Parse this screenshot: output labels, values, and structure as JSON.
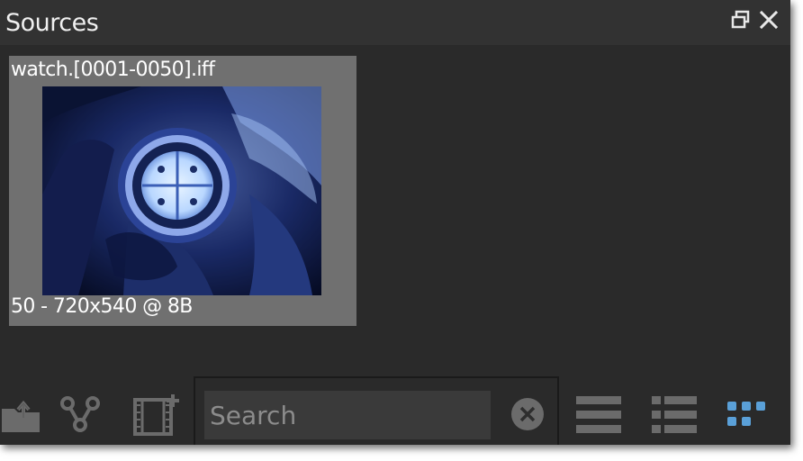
{
  "panel": {
    "title": "Sources",
    "accent_color": "#5aa0d8"
  },
  "source_item": {
    "name": "watch.[0001-0050].iff",
    "info": "50 - 720x540 @ 8B"
  },
  "toolbar": {
    "icons": [
      "import-folder-icon",
      "node-graph-icon",
      "add-clip-icon",
      "list-view-icon",
      "detail-view-icon",
      "grid-view-icon"
    ],
    "search_placeholder": "Search",
    "active_view": "grid"
  }
}
